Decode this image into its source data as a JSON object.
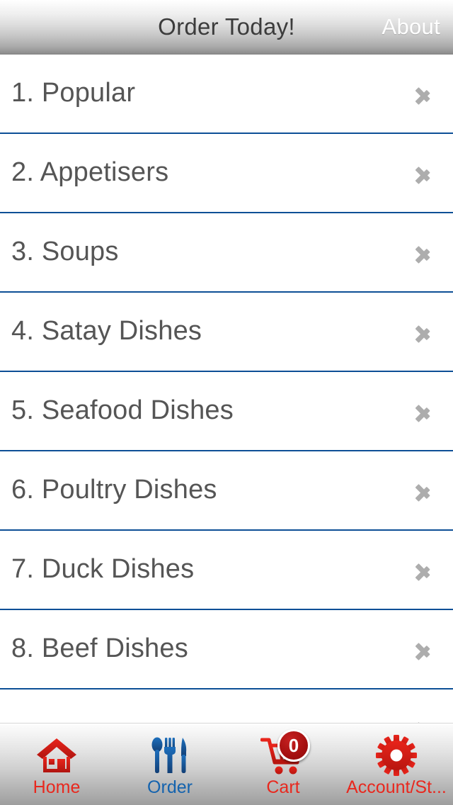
{
  "header": {
    "title": "Order Today!",
    "about_label": "About"
  },
  "menu": {
    "items": [
      {
        "label": "1. Popular",
        "chevron": "chevron-right-icon"
      },
      {
        "label": "2. Appetisers",
        "chevron": "chevron-right-icon"
      },
      {
        "label": "3. Soups",
        "chevron": "chevron-right-icon"
      },
      {
        "label": "4. Satay Dishes",
        "chevron": "chevron-right-icon"
      },
      {
        "label": "5. Seafood Dishes",
        "chevron": "chevron-right-icon"
      },
      {
        "label": "6. Poultry Dishes",
        "chevron": "chevron-right-icon"
      },
      {
        "label": "7. Duck Dishes",
        "chevron": "chevron-right-icon"
      },
      {
        "label": "8. Beef Dishes",
        "chevron": "chevron-right-icon"
      },
      {
        "label": "",
        "chevron": "chevron-right-icon"
      }
    ]
  },
  "tabbar": {
    "tabs": [
      {
        "label": "Home",
        "icon": "home-icon",
        "color": "red"
      },
      {
        "label": "Order",
        "icon": "cutlery-icon",
        "color": "blue"
      },
      {
        "label": "Cart",
        "icon": "cart-icon",
        "color": "red",
        "badge": "0"
      },
      {
        "label": "Account/St...",
        "icon": "gear-icon",
        "color": "red"
      }
    ]
  },
  "colors": {
    "separator_blue": "#0d4f96",
    "accent_red": "#e8281e",
    "accent_blue": "#1463ae",
    "badge_red": "#a30e0e",
    "list_text": "#555555",
    "chevron_gray": "#adadad"
  }
}
